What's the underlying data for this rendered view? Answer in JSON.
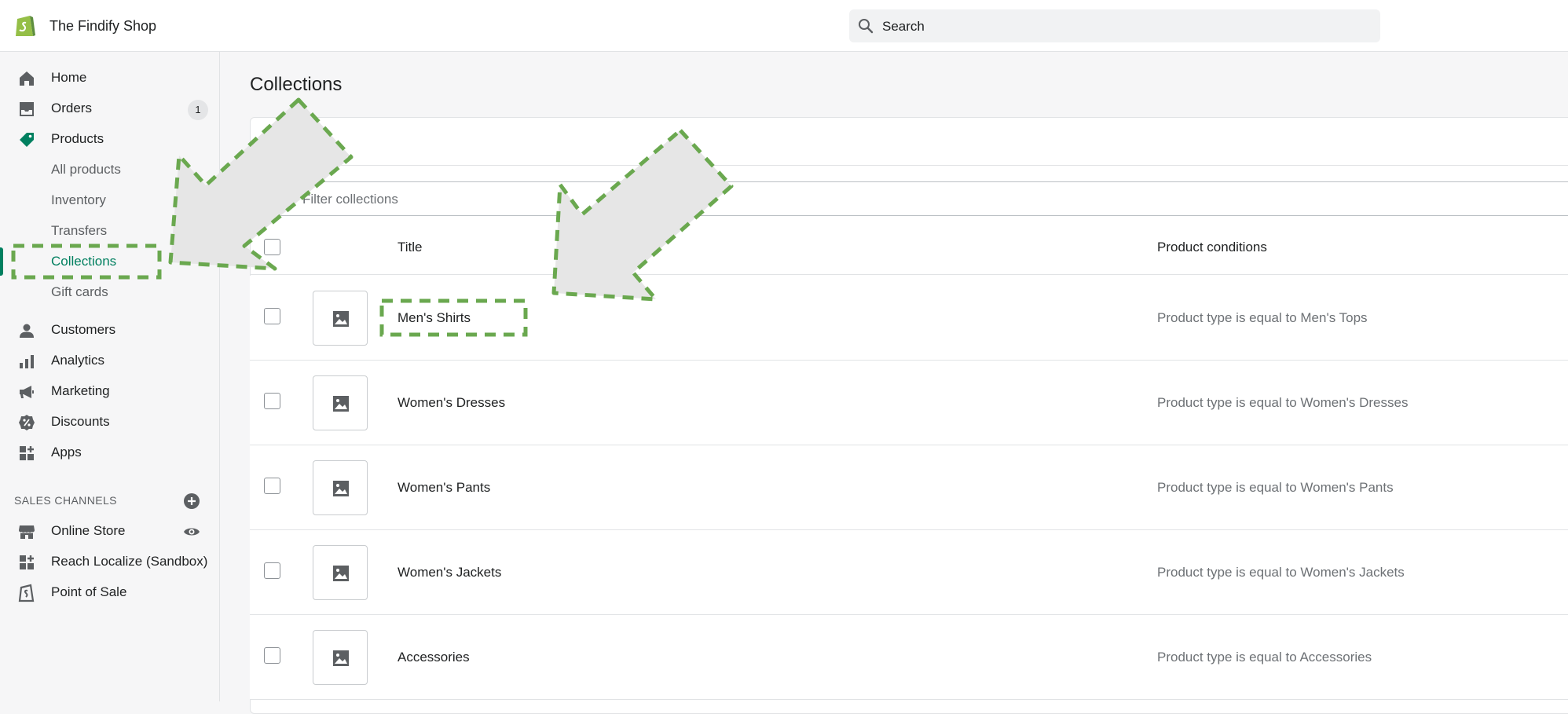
{
  "header": {
    "shop_name": "The Findify Shop",
    "search_label": "Search"
  },
  "sidebar": {
    "items": [
      {
        "label": "Home",
        "icon": "home-icon"
      },
      {
        "label": "Orders",
        "icon": "orders-icon",
        "badge": "1"
      },
      {
        "label": "Products",
        "icon": "tag-icon"
      },
      {
        "label": "All products"
      },
      {
        "label": "Inventory"
      },
      {
        "label": "Transfers"
      },
      {
        "label": "Collections",
        "active": true
      },
      {
        "label": "Gift cards"
      },
      {
        "label": "Customers",
        "icon": "person-icon"
      },
      {
        "label": "Analytics",
        "icon": "bar-chart-icon"
      },
      {
        "label": "Marketing",
        "icon": "megaphone-icon"
      },
      {
        "label": "Discounts",
        "icon": "discount-icon"
      },
      {
        "label": "Apps",
        "icon": "apps-icon"
      }
    ],
    "sales_channels_title": "SALES CHANNELS",
    "channels": [
      {
        "label": "Online Store",
        "icon": "store-icon"
      },
      {
        "label": "Reach Localize (Sandbox)",
        "icon": "apps-icon"
      },
      {
        "label": "Point of Sale",
        "icon": "pos-icon"
      }
    ]
  },
  "main": {
    "page_title": "Collections",
    "filter_placeholder": "Filter collections",
    "columns": {
      "title": "Title",
      "conditions": "Product conditions"
    },
    "rows": [
      {
        "title": "Men's Shirts",
        "conditions": "Product type is equal to Men's Tops"
      },
      {
        "title": "Women's Dresses",
        "conditions": "Product type is equal to Women's Dresses"
      },
      {
        "title": "Women's Pants",
        "conditions": "Product type is equal to Women's Pants"
      },
      {
        "title": "Women's Jackets",
        "conditions": "Product type is equal to Women's Jackets"
      },
      {
        "title": "Accessories",
        "conditions": "Product type is equal to Accessories"
      }
    ]
  },
  "colors": {
    "accent": "#007f5f",
    "annotation_green": "#6aa84f",
    "annotation_fill": "#e6e6e6"
  }
}
